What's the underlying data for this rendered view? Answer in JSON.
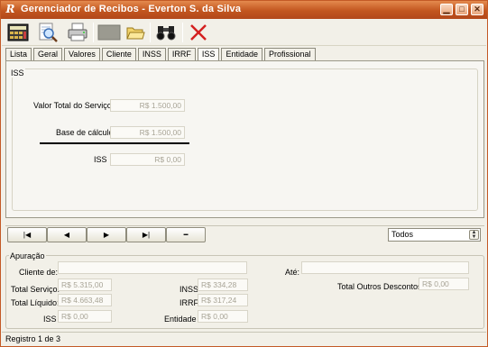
{
  "window": {
    "title": "Gerenciador de Recibos - Everton S. da Silva",
    "app_icon_glyph": "R",
    "minimize_glyph": "▁",
    "maximize_glyph": "□",
    "close_glyph": "✕"
  },
  "toolbar": {
    "icons": [
      "calculator-icon",
      "search-document-icon",
      "printer-icon",
      "blank-document-icon",
      "open-folder-icon",
      "binoculars-icon",
      "delete-icon"
    ]
  },
  "tabs": [
    "Lista",
    "Geral",
    "Valores",
    "Cliente",
    "INSS",
    "IRRF",
    "ISS",
    "Entidade",
    "Profissional"
  ],
  "active_tab": "ISS",
  "iss_panel": {
    "group_title": "ISS",
    "valor_total_label": "Valor Total do Serviço",
    "valor_total_value": "R$ 1.500,00",
    "base_calculo_label": "Base de cálculo",
    "base_calculo_value": "R$ 1.500,00",
    "iss_label": "ISS",
    "iss_value": "R$ 0,00"
  },
  "navigation": {
    "first": "|◀",
    "prev": "◀",
    "next": "▶",
    "last": "▶|",
    "delete": "━",
    "filter_selected": "Todos"
  },
  "apuracao": {
    "group_title": "Apuração",
    "cliente_de_label": "Cliente de:",
    "cliente_de_value": "",
    "ate_label": "Até:",
    "ate_value": "",
    "total_servico_label": "Total Serviço:",
    "total_servico_value": "R$ 5.315,00",
    "total_liquido_label": "Total Líquido:",
    "total_liquido_value": "R$ 4.663,48",
    "iss_label": "ISS",
    "iss_value": "R$ 0,00",
    "inss_label": "INSS",
    "inss_value": "R$ 334,28",
    "irrf_label": "IRRF",
    "irrf_value": "R$ 317,24",
    "entidade_label": "Entidade",
    "entidade_value": "R$ 0,00",
    "outros_label": "Total Outros Descontos:",
    "outros_value": "R$ 0,00"
  },
  "status": {
    "text": "Registro 1 de 3"
  },
  "colors": {
    "titlebar": "#c2561f",
    "delete_red": "#d42020"
  }
}
